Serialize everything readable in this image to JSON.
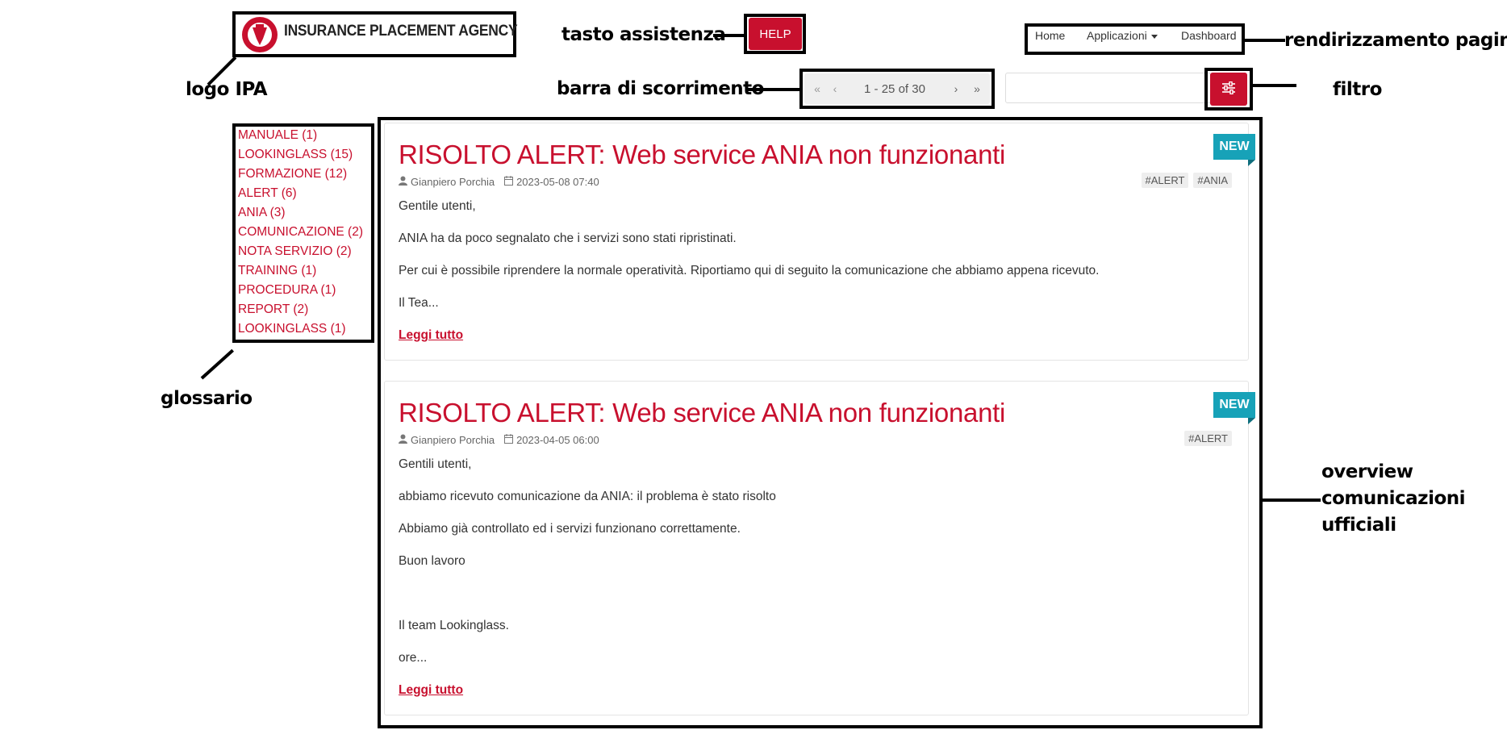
{
  "logo": {
    "text": "INSURANCE PLACEMENT AGENCY"
  },
  "help": {
    "label": "HELP"
  },
  "nav": {
    "home": "Home",
    "applications": "Applicazioni",
    "dashboard": "Dashboard"
  },
  "pagination": {
    "first": "«",
    "prev": "‹",
    "range": "1 - 25 of 30",
    "next": "›",
    "last": "»"
  },
  "search": {
    "value": "",
    "placeholder": ""
  },
  "glossary": [
    "MANUALE (1)",
    "LOOKINGLASS (15)",
    "FORMAZIONE (12)",
    "ALERT (6)",
    "ANIA (3)",
    "COMUNICAZIONE (2)",
    "NOTA SERVIZIO (2)",
    "TRAINING (1)",
    "PROCEDURA (1)",
    "REPORT (2)",
    "LOOKINGLASS (1)"
  ],
  "posts": [
    {
      "badge": "NEW",
      "title": "RISOLTO ALERT: Web service ANIA non funzionanti",
      "author": "Gianpiero Porchia",
      "date": "2023-05-08 07:40",
      "tags": [
        "#ALERT",
        "#ANIA"
      ],
      "lines": [
        "Gentile utenti,",
        "ANIA ha da poco segnalato che i servizi sono stati ripristinati.",
        "Per cui è possibile riprendere la normale operatività. Riportiamo qui di seguito la comunicazione che abbiamo appena ricevuto.",
        "Il Tea..."
      ],
      "read_more": "Leggi tutto"
    },
    {
      "badge": "NEW",
      "title": "RISOLTO ALERT: Web service ANIA non funzionanti",
      "author": "Gianpiero Porchia",
      "date": "2023-04-05 06:00",
      "tags": [
        "#ALERT"
      ],
      "lines": [
        "Gentili utenti,",
        "abbiamo ricevuto comunicazione da ANIA: il problema è stato risolto",
        "Abbiamo già controllato ed i servizi funzionano correttamente.",
        "Buon lavoro",
        "Il team Lookinglass.",
        "ore..."
      ],
      "read_more": "Leggi tutto"
    }
  ],
  "annotations": {
    "logo": "logo IPA",
    "help": "tasto  assistenza",
    "nav": "rendirizzamento pagine",
    "pagination": "barra di scorrimento",
    "filter": "filtro",
    "glossary": "glossario",
    "overview_1": "overview",
    "overview_2": "comunicazioni",
    "overview_3": "ufficiali"
  },
  "colors": {
    "accent": "#c8102e",
    "badge": "#17a2b8",
    "annotation": "#000000"
  },
  "icons": {
    "filter": "sliders-icon",
    "author": "user-icon",
    "date": "calendar-icon",
    "caret": "caret-down-icon"
  }
}
